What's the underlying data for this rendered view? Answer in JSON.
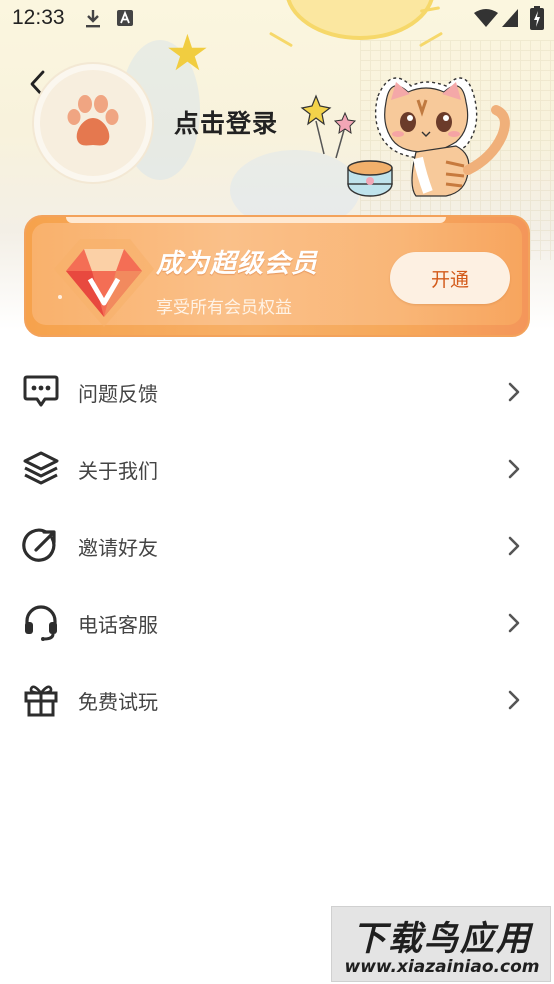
{
  "status_bar": {
    "time": "12:33",
    "icons": [
      "download-icon",
      "a-notification-icon",
      "wifi-icon",
      "signal-icon",
      "battery-charging-icon"
    ]
  },
  "header": {
    "back_icon": "chevron-left-icon",
    "avatar_icon": "paw-icon",
    "login_label": "点击登录",
    "illustration": "cat-illustration"
  },
  "vip_card": {
    "title": "成为超级会员",
    "subtitle": "享受所有会员权益",
    "button_label": "开通",
    "icon": "diamond-icon"
  },
  "menu": {
    "items": [
      {
        "label": "问题反馈",
        "icon": "chat-bubble-icon"
      },
      {
        "label": "关于我们",
        "icon": "layers-icon"
      },
      {
        "label": "邀请好友",
        "icon": "share-arrow-icon"
      },
      {
        "label": "电话客服",
        "icon": "headset-icon"
      },
      {
        "label": "免费试玩",
        "icon": "gift-icon"
      }
    ],
    "chevron_icon": "chevron-right-icon"
  },
  "watermark": {
    "title": "下载鸟应用",
    "url": "www.xiazainiao.com"
  },
  "colors": {
    "vip_orange": "#f6a24c",
    "vip_button_text": "#d35a1a",
    "header_bg": "#fbf6df",
    "text_primary": "#222222",
    "text_menu": "#444444"
  }
}
